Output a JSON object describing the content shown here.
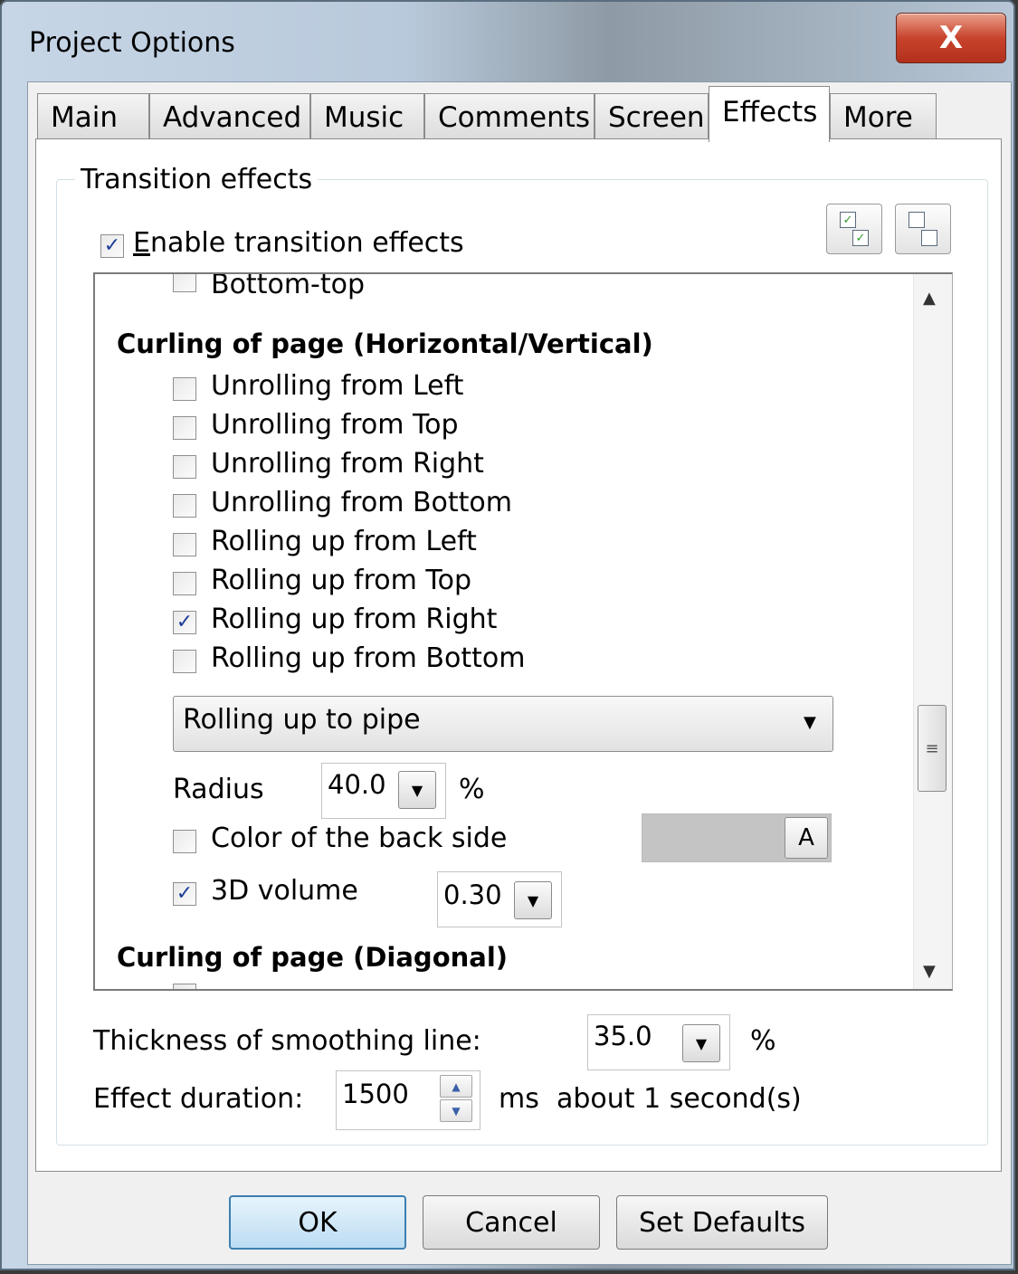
{
  "window": {
    "title": "Project Options",
    "close_glyph": "X"
  },
  "tabs": [
    {
      "label": "Main"
    },
    {
      "label": "Advanced"
    },
    {
      "label": "Music"
    },
    {
      "label": "Comments"
    },
    {
      "label": "Screen"
    },
    {
      "label": "Effects",
      "active": true
    },
    {
      "label": "More"
    }
  ],
  "group": {
    "label": "Transition effects",
    "enable": {
      "label": "Enable transition effects",
      "accel_key": "E",
      "checked": true
    }
  },
  "toolbar": {
    "check_all_icon": "check-all-icon",
    "uncheck_all_icon": "uncheck-all-icon"
  },
  "effects_list": {
    "partial_item": {
      "label": "Bottom-top",
      "checked": false
    },
    "section_horizontal": "Curling of page (Horizontal/Vertical)",
    "items": [
      {
        "label": "Unrolling from Left",
        "checked": false
      },
      {
        "label": "Unrolling from Top",
        "checked": false
      },
      {
        "label": "Unrolling from Right",
        "checked": false
      },
      {
        "label": "Unrolling from Bottom",
        "checked": false
      },
      {
        "label": "Rolling up from Left",
        "checked": false
      },
      {
        "label": "Rolling up from Top",
        "checked": false
      },
      {
        "label": "Rolling up from Right",
        "checked": true
      },
      {
        "label": "Rolling up from Bottom",
        "checked": false
      }
    ],
    "mode_select": {
      "value": "Rolling up to pipe"
    },
    "radius": {
      "label": "Radius",
      "value": "40.0",
      "unit": "%"
    },
    "back_color": {
      "label": "Color of the back side",
      "checked": false,
      "button_label": "A",
      "color": "#c4c4c4"
    },
    "volume_3d": {
      "label": "3D volume",
      "checked": true,
      "value": "0.30"
    },
    "section_diagonal": "Curling of page (Diagonal)"
  },
  "smoothing": {
    "label": "Thickness of smoothing line:",
    "value": "35.0",
    "unit": "%"
  },
  "duration": {
    "label": "Effect duration:",
    "value": "1500",
    "unit": "ms",
    "hint": "about 1 second(s)"
  },
  "buttons": {
    "ok": "OK",
    "cancel": "Cancel",
    "defaults": "Set Defaults"
  },
  "colors": {
    "default_button_border": "#3c7fb1",
    "close_button": "#c8432c",
    "checkmark": "#1d3f9a"
  }
}
